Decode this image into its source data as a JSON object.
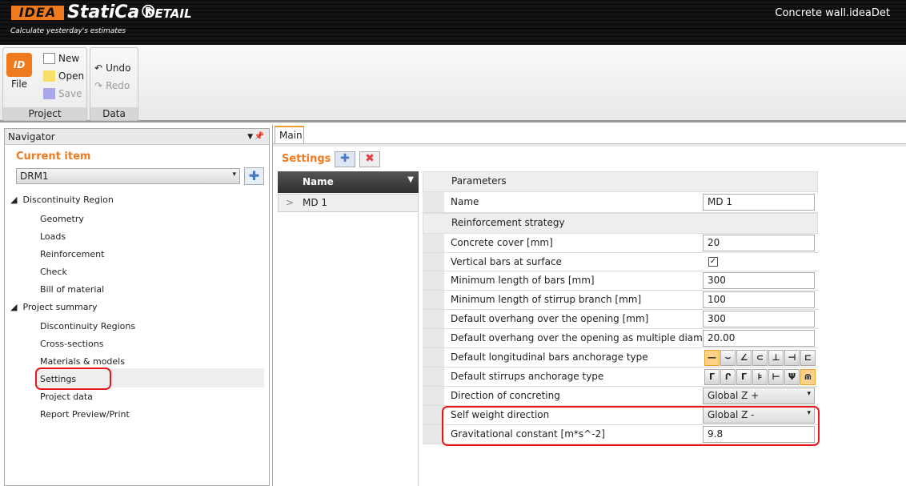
{
  "header": {
    "logo_mark": "IDEA",
    "logo_text": "StatiCa®",
    "product": "DETAIL",
    "tagline": "Calculate yesterday's estimates",
    "file_title": "Concrete wall.ideaDet"
  },
  "ribbon": {
    "file": "File",
    "new": "New",
    "open": "Open",
    "save": "Save",
    "project_group": "Project",
    "undo": "Undo",
    "redo": "Redo",
    "data_group": "Data"
  },
  "navigator": {
    "title": "Navigator",
    "current_item_label": "Current item",
    "current_item": "DRM1",
    "groups": [
      {
        "label": "Discontinuity Region",
        "items": [
          "Geometry",
          "Loads",
          "Reinforcement",
          "Check",
          "Bill of material"
        ]
      },
      {
        "label": "Project summary",
        "items": [
          "Discontinuity Regions",
          "Cross-sections",
          "Materials & models",
          "Settings",
          "Project data",
          "Report Preview/Print"
        ]
      }
    ],
    "selected": "Settings"
  },
  "main": {
    "tab": "Main",
    "settings_title": "Settings",
    "list_header": "Name",
    "list_items": [
      "MD 1"
    ],
    "params_header": "Parameters",
    "name_label": "Name",
    "name_value": "MD 1",
    "section": "Reinforcement strategy",
    "rows": [
      {
        "label": "Concrete cover [mm]",
        "value": "20"
      },
      {
        "label": "Vertical bars at surface",
        "checked": true
      },
      {
        "label": "Minimum length of bars [mm]",
        "value": "300"
      },
      {
        "label": "Minimum length of stirrup branch [mm]",
        "value": "100"
      },
      {
        "label": "Default overhang over the opening [mm]",
        "value": "300"
      },
      {
        "label": "Default overhang over the opening as multiple diameter [-]",
        "value": "20.00"
      },
      {
        "label": "Default longitudinal bars anchorage type",
        "options": [
          "—",
          "⌣",
          "∠",
          "⊂",
          "⊥",
          "⊣",
          "⊏"
        ],
        "selected_index": 0
      },
      {
        "label": "Default stirrups anchorage type",
        "options": [
          "Γ",
          "Ր",
          "Γ",
          "⊧",
          "⊢",
          "Ψ",
          "⋒"
        ],
        "selected_index": 6
      },
      {
        "label": "Direction of concreting",
        "value": "Global Z +"
      },
      {
        "label": "Self weight direction",
        "value": "Global Z -"
      },
      {
        "label": "Gravitational constant [m*s^-2]",
        "value": "9.8"
      }
    ]
  }
}
